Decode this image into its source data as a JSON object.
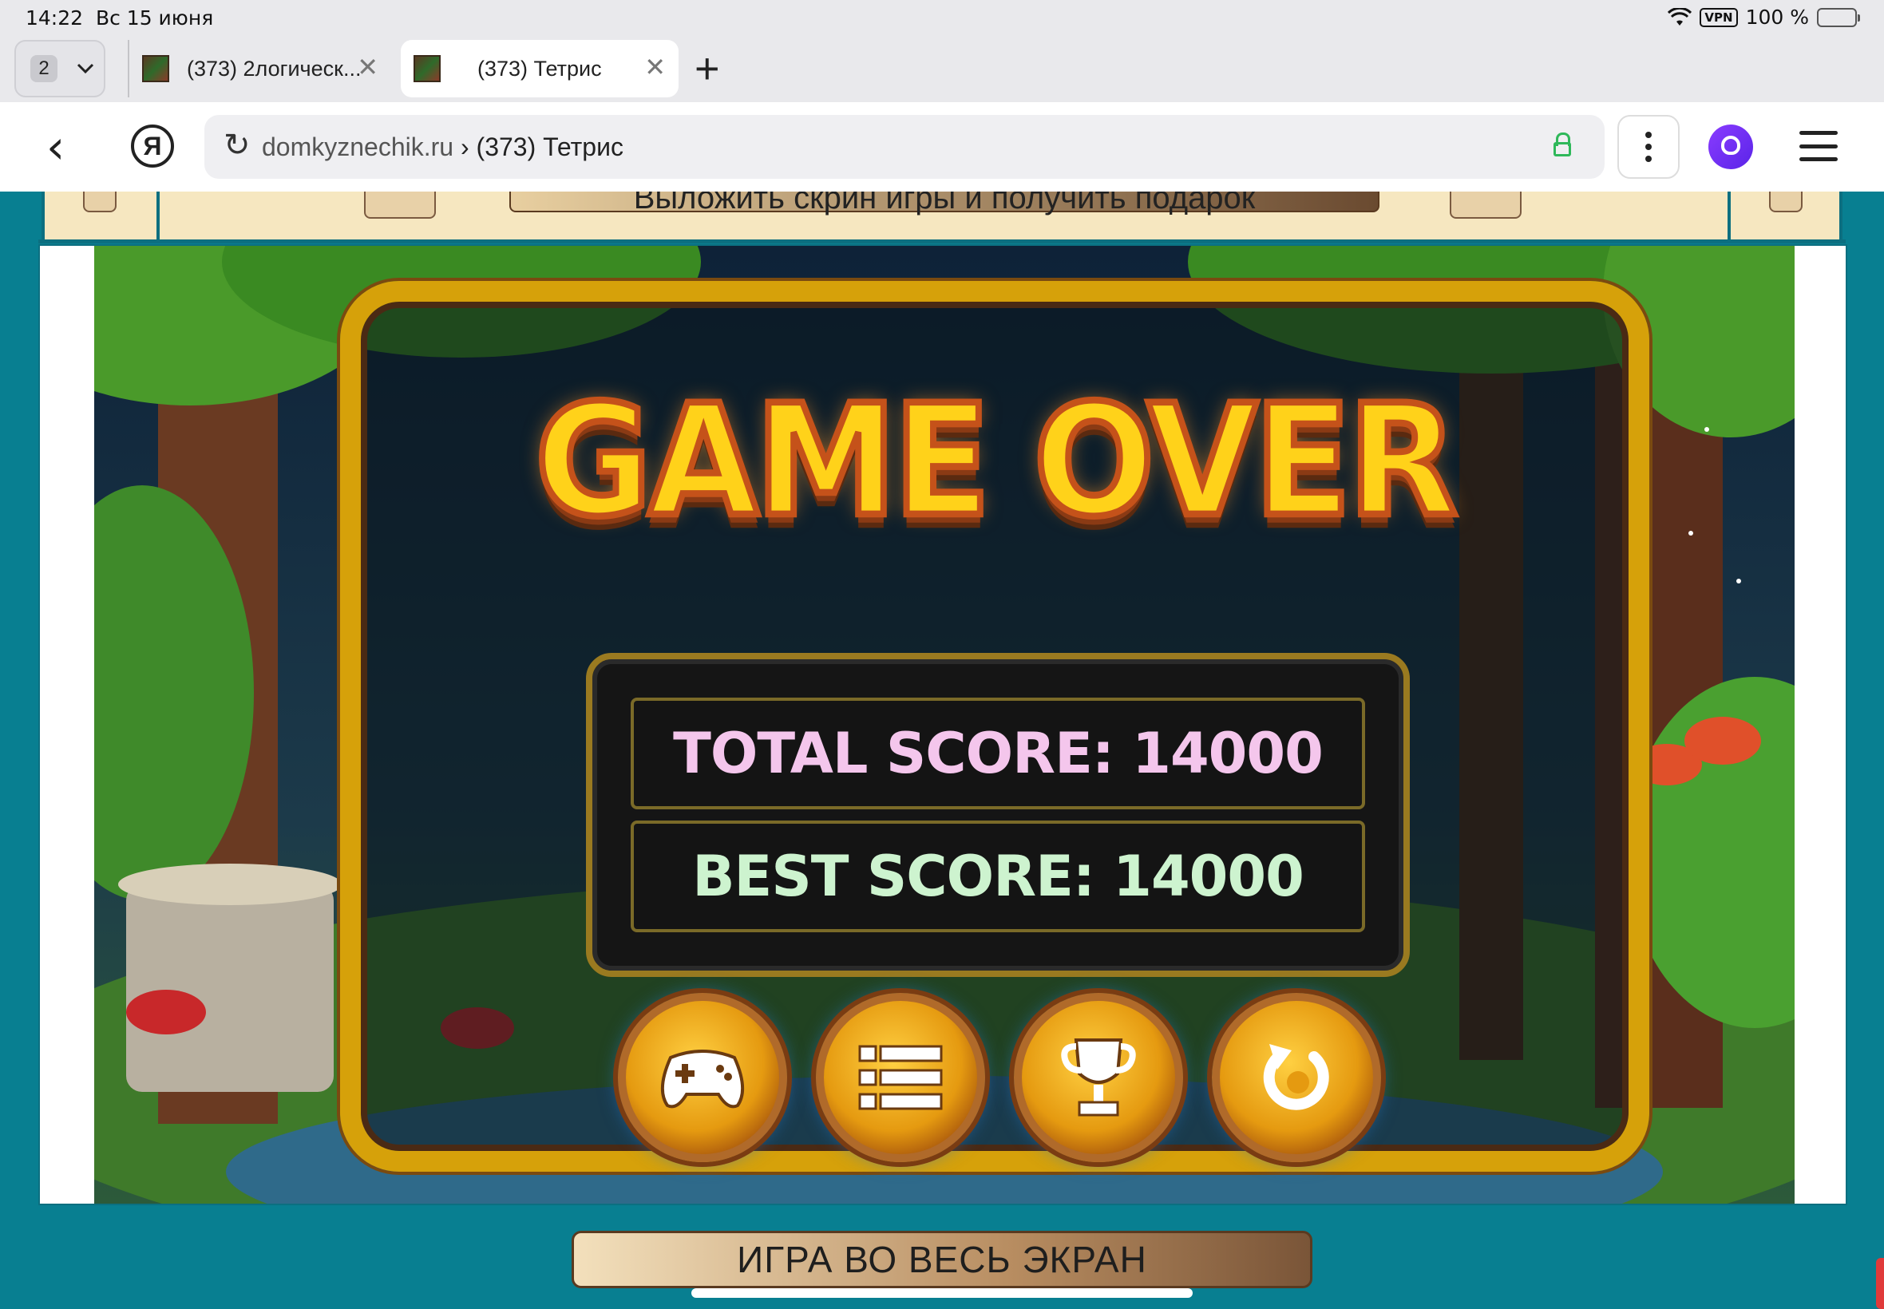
{
  "status_bar": {
    "time": "14:22",
    "date": "Вс 15 июня",
    "vpn": "VPN",
    "battery": "100 %"
  },
  "tabs": {
    "count": "2",
    "items": [
      {
        "title": "(373) 2логическ..."
      },
      {
        "title": "(373) Тетрис"
      }
    ]
  },
  "address_bar": {
    "domain": "domkyznechik.ru",
    "separator": "›",
    "page_title": "(373) Тетрис"
  },
  "banner": {
    "text": "Выложить скрин игры и получить подарок"
  },
  "game": {
    "title": "GAME OVER",
    "total_score": "TOTAL SCORE: 14000",
    "best_score": "BEST SCORE: 14000",
    "buttons": [
      "gamepad-icon",
      "list-icon",
      "trophy-icon",
      "restart-icon"
    ]
  },
  "fullscreen": {
    "label": "ИГРА ВО ВЕСЬ ЭКРАН"
  },
  "colors": {
    "teal_bg": "#087f91",
    "gold_frame": "#d6a10a",
    "total_score": "#f4c6ec",
    "best_score": "#cdf3cf"
  }
}
